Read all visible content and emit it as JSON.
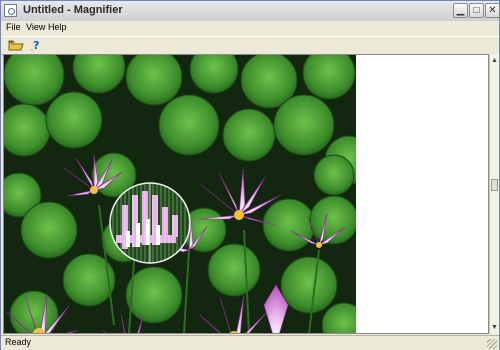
{
  "window": {
    "title": "Untitled - Magnifier"
  },
  "menu": {
    "items": [
      {
        "label": "File"
      },
      {
        "label": "View"
      },
      {
        "label": "Help"
      }
    ]
  },
  "toolbar": {
    "buttons": [
      {
        "icon": "open-folder-icon"
      },
      {
        "icon": "help-icon"
      }
    ]
  },
  "status": {
    "text": "Ready"
  },
  "image": {
    "subject": "water-lilies-photo",
    "has_magnifier_lens": true
  },
  "colors": {
    "accent": "#6a86c9",
    "chrome": "#ece9d8",
    "leaf": "#3f8f2f",
    "lily": "#c86ac8"
  }
}
